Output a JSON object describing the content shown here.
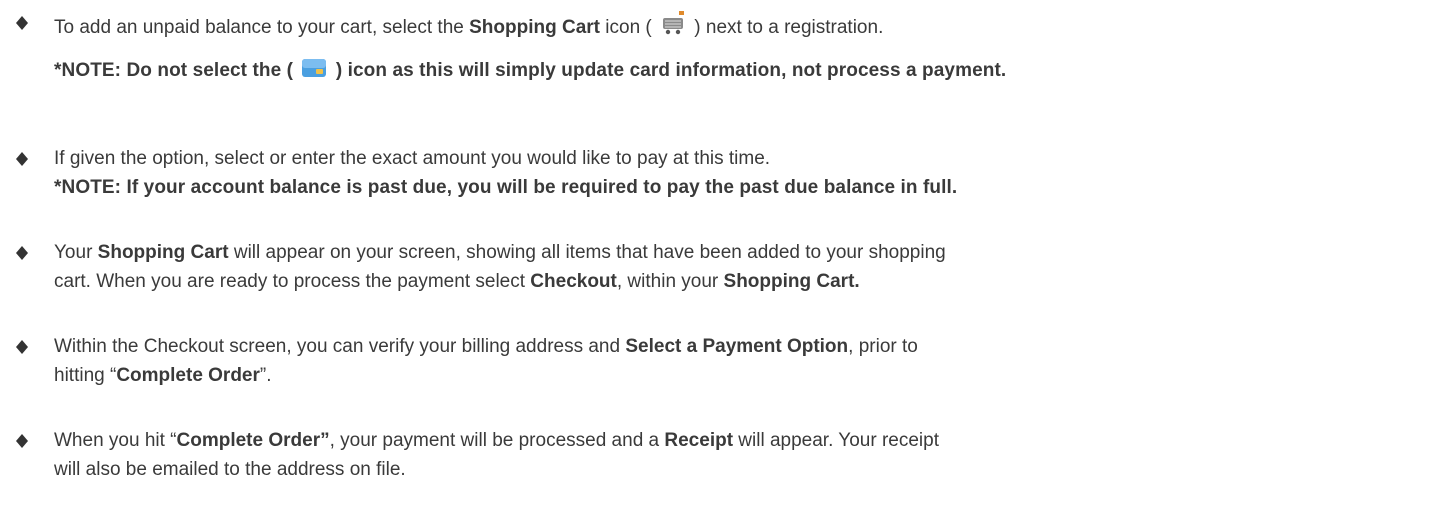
{
  "icons": {
    "bullet": "diamond-bullet-icon",
    "cart": "shopping-cart-icon",
    "card": "credit-card-icon",
    "accent_color": "#333333",
    "cart_color": "#8a8a8a",
    "cart_tag_color": "#e08a2b",
    "card_color": "#4a9fe0"
  },
  "items": [
    {
      "p1": "To add an unpaid balance to your cart, select the ",
      "b1": "Shopping Cart",
      "p2": " icon ( ",
      "p3": " ) next to a registration.",
      "note_a": "*NOTE: Do not select the ( ",
      "note_b": " ) icon as this will simply update card information, not process a payment."
    },
    {
      "p1": "If given the option, select or enter the exact amount you would like to pay at this time.",
      "note": "*NOTE: If your account balance is past due, you will be required to pay the past due balance in full."
    },
    {
      "p1": "Your ",
      "b1": "Shopping Cart",
      "p2": " will appear on your screen,  showing all items that have been added to your shopping",
      "p3": "cart. When you are ready to process the payment select ",
      "b2": "Checkout",
      "p4": ", within your ",
      "b3": "Shopping Cart."
    },
    {
      "p1": "Within the Checkout screen, you can verify your billing address and ",
      "b1": "Select a Payment Option",
      "p2": ", prior to",
      "p3": "hitting “",
      "b2": "Complete Order",
      "p4": "”."
    },
    {
      "p1": "When you hit “",
      "b1": "Complete Order”",
      "p2": ", your payment will be processed and a ",
      "b2": "Receipt",
      "p3": " will appear. Your receipt",
      "p4": "will also be emailed to the address on file."
    }
  ]
}
